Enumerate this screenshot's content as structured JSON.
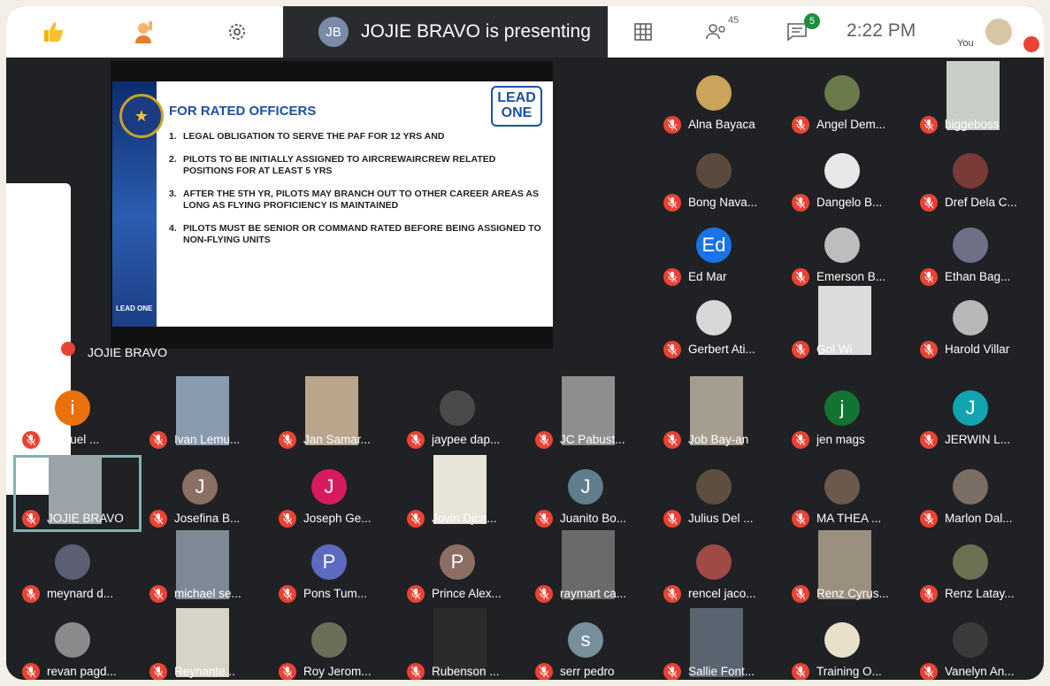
{
  "topbar": {
    "icons": [
      "thumbs-up-icon",
      "raise-hand-icon",
      "gear-icon"
    ],
    "presenting_text": "JOJIE BRAVO is presenting",
    "participants_count": "45",
    "chat_count": "5",
    "time": "2:22 PM",
    "you_label": "You"
  },
  "slide": {
    "title": "FOR RATED OFFICERS",
    "badge_line1": "LEAD",
    "badge_line2": "ONE",
    "items": [
      "LEGAL OBLIGATION TO SERVE THE PAF FOR 12 YRS AND",
      "PILOTS TO BE INITIALLY ASSIGNED TO AIRCREWAIRCREW RELATED POSITIONS FOR AT LEAST 5 YRS",
      "AFTER THE 5TH YR, PILOTS MAY BRANCH OUT TO OTHER CAREER AREAS AS LONG AS FLYING PROFICIENCY IS MAINTAINED",
      "PILOTS MUST BE SENIOR OR COMMAND RATED BEFORE BEING ASSIGNED TO NON-FLYING UNITS"
    ],
    "footer": "LEAD ONE"
  },
  "presenter_name": "JOJIE BRAVO",
  "participants": [
    {
      "name": "Alna Bayaca",
      "kind": "avatar",
      "color": "#c9a45a"
    },
    {
      "name": "Angel Dem...",
      "kind": "avatar",
      "color": "#6b7a4a"
    },
    {
      "name": "biggeboss",
      "kind": "photo",
      "color": "#c9cfc6"
    },
    {
      "name": "Bong Nava...",
      "kind": "avatar",
      "color": "#5a4a3e"
    },
    {
      "name": "Dangelo B...",
      "kind": "avatar",
      "color": "#e8e8e8"
    },
    {
      "name": "Dref Dela C...",
      "kind": "avatar",
      "color": "#7a3a38"
    },
    {
      "name": "Ed Mar",
      "kind": "letter",
      "initial": "Ed",
      "color": "#1a73e8"
    },
    {
      "name": "Emerson B...",
      "kind": "avatar",
      "color": "#bdbdbd"
    },
    {
      "name": "Ethan Bag...",
      "kind": "avatar",
      "color": "#6f6f86"
    },
    {
      "name": "Gerbert Ati...",
      "kind": "avatar",
      "color": "#d8d8d8"
    },
    {
      "name": "Gol Wi",
      "kind": "photo",
      "color": "#dcdcdc"
    },
    {
      "name": "Harold Villar",
      "kind": "avatar",
      "color": "#b8b8b8"
    },
    {
      "name": "manuel ...",
      "kind": "letter",
      "initial": "i",
      "color": "#e8710a"
    },
    {
      "name": "Ivan Lemu...",
      "kind": "photo",
      "color": "#8a9bb0"
    },
    {
      "name": "Jan Samar...",
      "kind": "photo",
      "color": "#b9a58c"
    },
    {
      "name": "jaypee dap...",
      "kind": "avatar",
      "color": "#4a4a4a"
    },
    {
      "name": "JC Pabust...",
      "kind": "photo",
      "color": "#8e8e8e"
    },
    {
      "name": "Job Bay-an",
      "kind": "photo",
      "color": "#a59d8f"
    },
    {
      "name": "jen mags",
      "kind": "letter",
      "initial": "j",
      "color": "#137333"
    },
    {
      "name": "JERWIN L...",
      "kind": "letter",
      "initial": "J",
      "color": "#12a4af"
    },
    {
      "name": "JOJIE BRAVO",
      "kind": "photo",
      "color": "#9aa3a8"
    },
    {
      "name": "Josefina B...",
      "kind": "letter",
      "initial": "J",
      "color": "#8d6e63"
    },
    {
      "name": "Joseph Ge...",
      "kind": "letter",
      "initial": "J",
      "color": "#d81b60"
    },
    {
      "name": "Jovin Djca...",
      "kind": "photo",
      "color": "#e9e4da"
    },
    {
      "name": "Juanito Bo...",
      "kind": "letter",
      "initial": "J",
      "color": "#607d8b"
    },
    {
      "name": "Julius Del ...",
      "kind": "avatar",
      "color": "#5d4f3e"
    },
    {
      "name": "MA THEA ...",
      "kind": "avatar",
      "color": "#6b5a4b"
    },
    {
      "name": "Marlon Dal...",
      "kind": "avatar",
      "color": "#7b6e64"
    },
    {
      "name": "meynard d...",
      "kind": "avatar",
      "color": "#5a5f73"
    },
    {
      "name": "michael se...",
      "kind": "photo",
      "color": "#7d8a96"
    },
    {
      "name": "Pons Tum...",
      "kind": "letter",
      "initial": "P",
      "color": "#5c6bc0"
    },
    {
      "name": "Prince Alex...",
      "kind": "letter",
      "initial": "P",
      "color": "#8d6e63"
    },
    {
      "name": "raymart ca...",
      "kind": "photo",
      "color": "#6a6a6a"
    },
    {
      "name": "rencel jaco...",
      "kind": "avatar",
      "color": "#a04a45"
    },
    {
      "name": "Renz Cyrus...",
      "kind": "photo",
      "color": "#9b8f80"
    },
    {
      "name": "Renz Latay...",
      "kind": "avatar",
      "color": "#6d7052"
    },
    {
      "name": "revan pagd...",
      "kind": "avatar",
      "color": "#8a8a8a"
    },
    {
      "name": "Reynante...",
      "kind": "photo",
      "color": "#d7d3c6"
    },
    {
      "name": "Roy Jerom...",
      "kind": "avatar",
      "color": "#6a6f5a"
    },
    {
      "name": "Rubenson ...",
      "kind": "photo",
      "color": "#2b2b2b"
    },
    {
      "name": "serr pedro",
      "kind": "letter",
      "initial": "s",
      "color": "#78909c"
    },
    {
      "name": "Sallie Font...",
      "kind": "photo",
      "color": "#5a6470"
    },
    {
      "name": "Training O...",
      "kind": "avatar",
      "color": "#e8e0c8"
    },
    {
      "name": "Vanelyn An...",
      "kind": "avatar",
      "color": "#3a3a3a"
    }
  ]
}
